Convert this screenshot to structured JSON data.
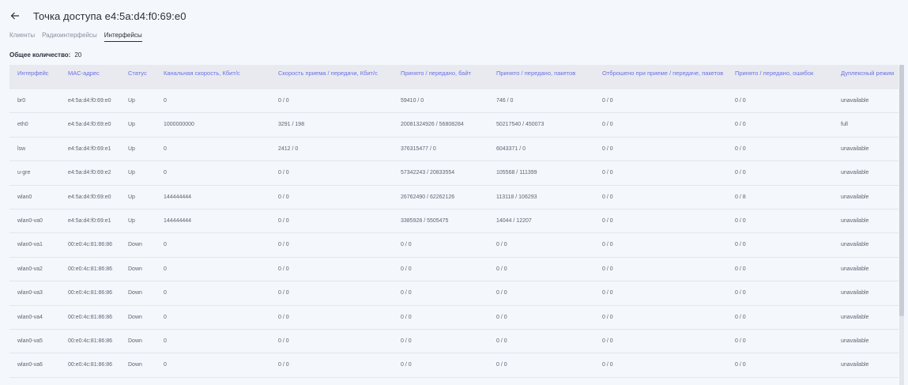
{
  "header": {
    "title": "Точка доступа e4:5a:d4:f0:69:e0",
    "back_icon": "arrow-left-icon"
  },
  "tabs": [
    {
      "label": "Клиенты",
      "active": false
    },
    {
      "label": "Радиоинтерфейсы",
      "active": false
    },
    {
      "label": "Интерфейсы",
      "active": true
    }
  ],
  "summary": {
    "label": "Общее количество:",
    "value": "20"
  },
  "table": {
    "columns": [
      "Интерфейс",
      "MAC-адрес",
      "Статус",
      "Канальная скорость, Кбит/с",
      "Скорость приема / передачи, Кбит/с",
      "Принято / передано, байт",
      "Принято / передано, пакетов",
      "Отброшено при приеме / передаче, пакетов",
      "Принято / передано, ошибок",
      "Дуплексный режим"
    ],
    "rows": [
      [
        "br0",
        "e4:5a:d4:f0:69:e0",
        "Up",
        "0",
        "0 / 0",
        "59410 / 0",
        "746 / 0",
        "0 / 0",
        "0 / 0",
        "unavailable"
      ],
      [
        "eth0",
        "e4:5a:d4:f0:69:e0",
        "Up",
        "1000000000",
        "3291 / 198",
        "20081324926 / 56808284",
        "50217540 / 450073",
        "0 / 0",
        "0 / 0",
        "full"
      ],
      [
        "lsw",
        "e4:5a:d4:f0:69:e1",
        "Up",
        "0",
        "2412 / 0",
        "376315477 / 0",
        "6043371 / 0",
        "0 / 0",
        "0 / 0",
        "unavailable"
      ],
      [
        "u-gre",
        "e4:5a:d4:f0:69:e2",
        "Up",
        "0",
        "0 / 0",
        "57342243 / 20833554",
        "105568 / 111399",
        "0 / 0",
        "0 / 0",
        "unavailable"
      ],
      [
        "wlan0",
        "e4:5a:d4:f0:69:e0",
        "Up",
        "144444444",
        "0 / 0",
        "26762490 / 62262126",
        "113118 / 106293",
        "0 / 0",
        "0 / 8",
        "unavailable"
      ],
      [
        "wlan0-va0",
        "e4:5a:d4:f0:69:e1",
        "Up",
        "144444444",
        "0 / 0",
        "3385928 / 5505475",
        "14044 / 12207",
        "0 / 0",
        "0 / 0",
        "unavailable"
      ],
      [
        "wlan0-va1",
        "00:e0:4c:81:86:86",
        "Down",
        "0",
        "0 / 0",
        "0 / 0",
        "0 / 0",
        "0 / 0",
        "0 / 0",
        "unavailable"
      ],
      [
        "wlan0-va2",
        "00:e0:4c:81:86:86",
        "Down",
        "0",
        "0 / 0",
        "0 / 0",
        "0 / 0",
        "0 / 0",
        "0 / 0",
        "unavailable"
      ],
      [
        "wlan0-va3",
        "00:e0:4c:81:86:86",
        "Down",
        "0",
        "0 / 0",
        "0 / 0",
        "0 / 0",
        "0 / 0",
        "0 / 0",
        "unavailable"
      ],
      [
        "wlan0-va4",
        "00:e0:4c:81:86:86",
        "Down",
        "0",
        "0 / 0",
        "0 / 0",
        "0 / 0",
        "0 / 0",
        "0 / 0",
        "unavailable"
      ],
      [
        "wlan0-va5",
        "00:e0:4c:81:86:86",
        "Down",
        "0",
        "0 / 0",
        "0 / 0",
        "0 / 0",
        "0 / 0",
        "0 / 0",
        "unavailable"
      ],
      [
        "wlan0-va6",
        "00:e0:4c:81:86:86",
        "Down",
        "0",
        "0 / 0",
        "0 / 0",
        "0 / 0",
        "0 / 0",
        "0 / 0",
        "unavailable"
      ]
    ]
  },
  "colors": {
    "header_text": "#6b6fe6",
    "table_header_bg": "#e8eaef",
    "page_bg": "#f4f7fc"
  }
}
